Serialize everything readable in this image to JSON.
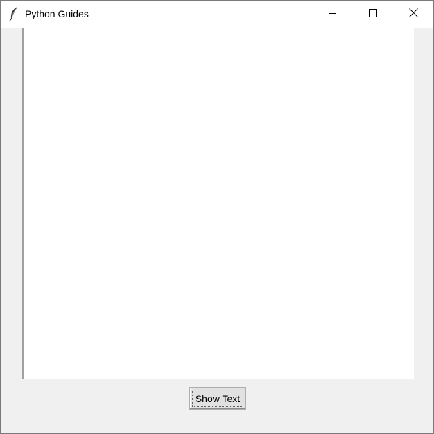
{
  "window": {
    "title": "Python Guides",
    "icon": "feather-icon",
    "controls": {
      "minimize_icon": "minimize-icon",
      "maximize_icon": "maximize-icon",
      "close_icon": "close-icon"
    }
  },
  "main": {
    "text_area_value": "",
    "show_button_label": "Show Text"
  }
}
